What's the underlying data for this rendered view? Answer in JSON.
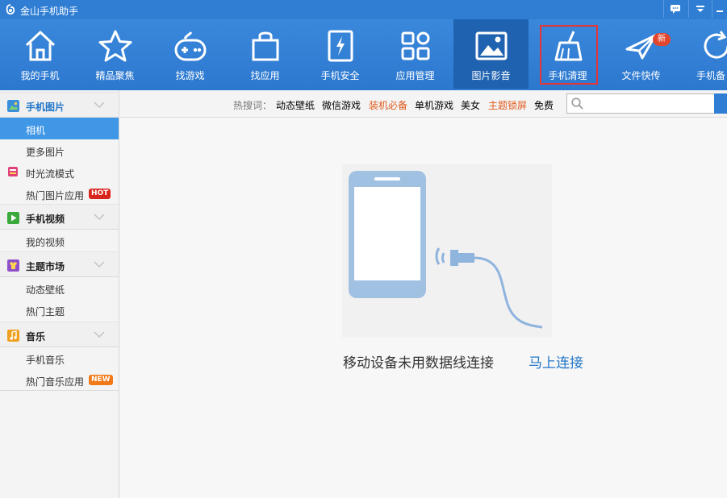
{
  "app": {
    "title": "金山手机助手"
  },
  "toolbar": {
    "items": [
      {
        "label": "我的手机",
        "icon": "home-icon"
      },
      {
        "label": "精品聚焦",
        "icon": "star-icon"
      },
      {
        "label": "找游戏",
        "icon": "gamepad-icon"
      },
      {
        "label": "找应用",
        "icon": "shopping-bag-icon"
      },
      {
        "label": "手机安全",
        "icon": "shield-phone-icon"
      },
      {
        "label": "应用管理",
        "icon": "app-grid-icon"
      },
      {
        "label": "图片影音",
        "icon": "picture-icon",
        "active": true
      },
      {
        "label": "手机清理",
        "icon": "broom-icon",
        "highlighted": true
      },
      {
        "label": "文件快传",
        "icon": "paper-plane-icon",
        "badge": "新"
      },
      {
        "label": "手机备",
        "icon": "refresh-icon"
      }
    ]
  },
  "sidebar": {
    "sections": [
      {
        "label": "手机图片",
        "color": "#3b8fd9",
        "items": [
          {
            "label": "相机",
            "selected": true
          },
          {
            "label": "更多图片"
          },
          {
            "label": "时光流模式"
          },
          {
            "label": "热门图片应用",
            "tag": "HOT"
          }
        ]
      },
      {
        "label": "手机视频",
        "color": "#3aa83a",
        "items": [
          {
            "label": "我的视频"
          }
        ]
      },
      {
        "label": "主题市场",
        "color": "#8f4fc8",
        "items": [
          {
            "label": "动态壁纸"
          },
          {
            "label": "热门主题"
          }
        ]
      },
      {
        "label": "音乐",
        "color": "#f0a020",
        "items": [
          {
            "label": "手机音乐"
          },
          {
            "label": "热门音乐应用",
            "tag": "NEW"
          }
        ]
      }
    ]
  },
  "search": {
    "hot_label": "热搜词：",
    "keywords": [
      {
        "text": "动态壁纸",
        "color": "#222222"
      },
      {
        "text": "微信游戏",
        "color": "#222222"
      },
      {
        "text": "装机必备",
        "color": "#e05a1c"
      },
      {
        "text": "单机游戏",
        "color": "#222222"
      },
      {
        "text": "美女",
        "color": "#222222"
      },
      {
        "text": "主题锁屏",
        "color": "#e05a1c"
      },
      {
        "text": "免费",
        "color": "#222222"
      }
    ],
    "value": ""
  },
  "main": {
    "message": "移动设备未用数据线连接",
    "connect_link": "马上连接"
  },
  "colors": {
    "accent": "#2f7ed3",
    "selected": "#4097e6",
    "link": "#2377c8",
    "highlight_border": "#e53535"
  }
}
